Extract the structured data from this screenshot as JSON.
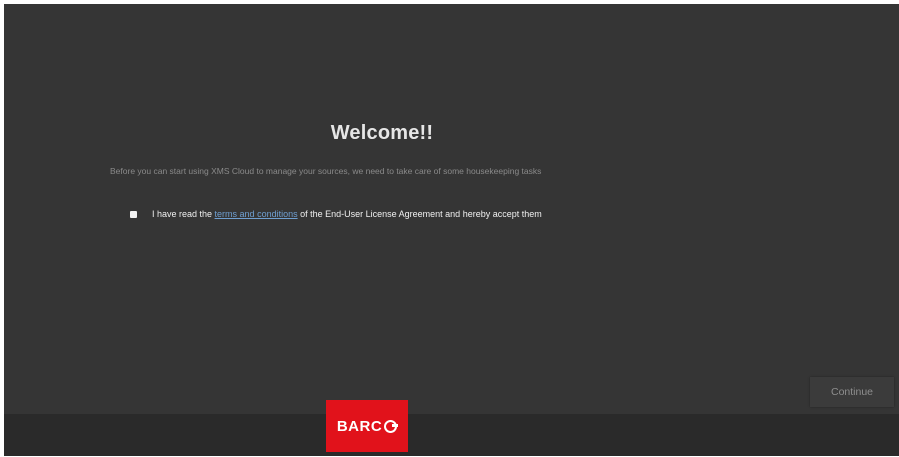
{
  "welcome": {
    "title": "Welcome!!",
    "subtitle": "Before you can start using XMS Cloud to manage your sources, we need to take care of some housekeeping tasks"
  },
  "agreement": {
    "checked": false,
    "text_before": "I have read the ",
    "link_text": "terms and conditions",
    "text_after": " of the End-User License Agreement and hereby accept them"
  },
  "actions": {
    "continue_label": "Continue"
  },
  "footer": {
    "logo_text": "BARC",
    "logo_icon": "barco-o-icon",
    "logo_color": "#e1121b"
  },
  "colors": {
    "background": "#353535",
    "footer": "#2a2a2a",
    "link": "#6f9fd1"
  }
}
